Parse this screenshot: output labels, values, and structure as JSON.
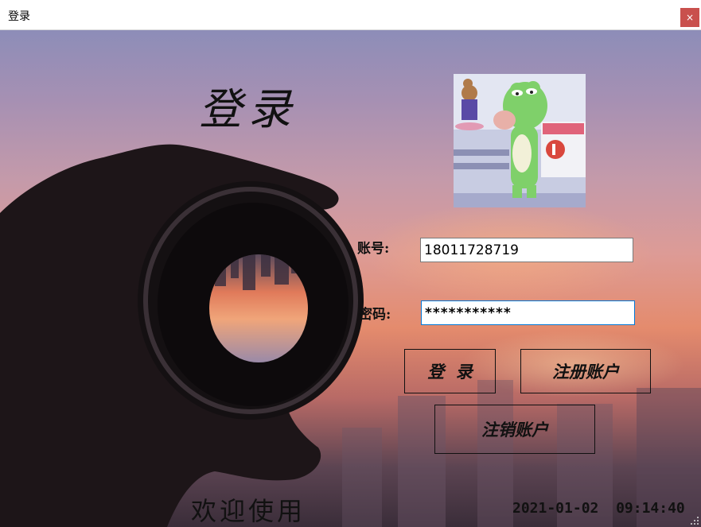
{
  "window": {
    "title": "登录",
    "close_label": "×"
  },
  "form": {
    "heading": "登录",
    "account_label": "账号:",
    "account_value": "18011728719",
    "password_label": "密码:",
    "password_value": "***********",
    "login_button": "登  录",
    "register_button": "注册账户",
    "cancel_account_button": "注销账户"
  },
  "footer": {
    "welcome": "欢迎使用",
    "date": "2021-01-02",
    "time": "09:14:40"
  },
  "colors": {
    "close_button": "#c9504d",
    "focus_border": "#0078d7"
  },
  "icons": {
    "avatar": "cartoon-frog-avatar",
    "close": "close-icon",
    "grip": "resize-grip-icon"
  }
}
